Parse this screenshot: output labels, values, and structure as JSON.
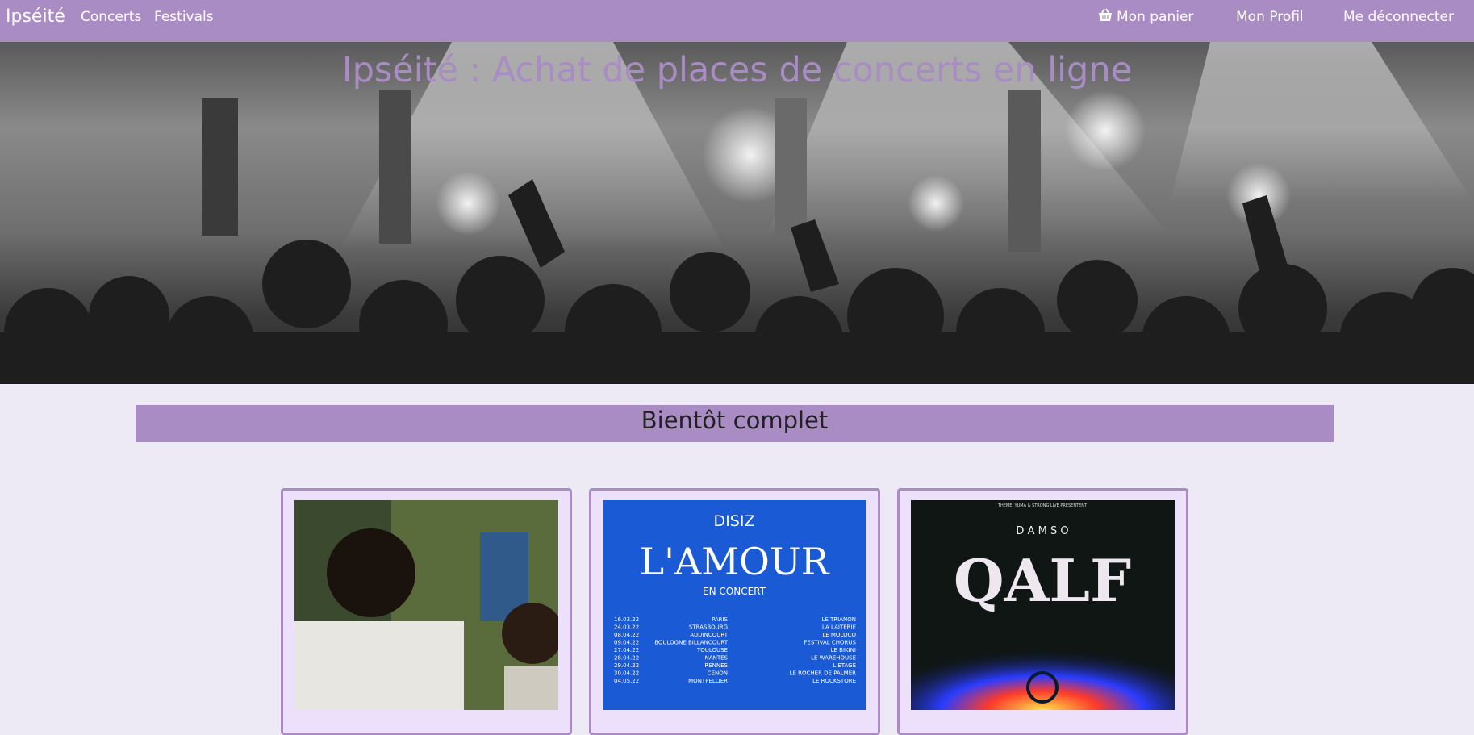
{
  "nav": {
    "brand": "Ipséité",
    "links": [
      "Concerts",
      "Festivals"
    ],
    "basket": "Mon panier",
    "profile": "Mon Profil",
    "logout": "Me déconnecter"
  },
  "hero": {
    "title": "Ipséité : Achat de places de concerts en ligne"
  },
  "section": {
    "title": "Bientôt complet"
  },
  "cards": [
    {
      "poster": "photo"
    },
    {
      "artist": "DISIZ",
      "title": "L'AMOUR",
      "subtitle": "EN CONCERT",
      "dates": [
        [
          "16.03.22",
          "PARIS",
          "LE TRIANON"
        ],
        [
          "24.03.22",
          "STRASBOURG",
          "LA LAITERIE"
        ],
        [
          "08.04.22",
          "AUDINCOURT",
          "LE MOLOCO"
        ],
        [
          "09.04.22",
          "BOULOGNE BILLANCOURT",
          "FESTIVAL CHORUS"
        ],
        [
          "27.04.22",
          "TOULOUSE",
          "LE BIKINI"
        ],
        [
          "28.04.22",
          "NANTES",
          "LE WAREHOUSE"
        ],
        [
          "29.04.22",
          "RENNES",
          "L'ETAGE"
        ],
        [
          "30.04.22",
          "CENON",
          "LE ROCHER DE PALMER"
        ],
        [
          "04.05.22",
          "MONTPELLIER",
          "LE ROCKSTORE"
        ]
      ]
    },
    {
      "presenter": "THEME, YUMA & STRONG LIVE PRÉSENTENT",
      "artist": "D A M S O",
      "title": "QALF"
    }
  ],
  "colors": {
    "accent": "#a98cc4",
    "background": "#edeaf5",
    "card": "#ece0fa"
  }
}
